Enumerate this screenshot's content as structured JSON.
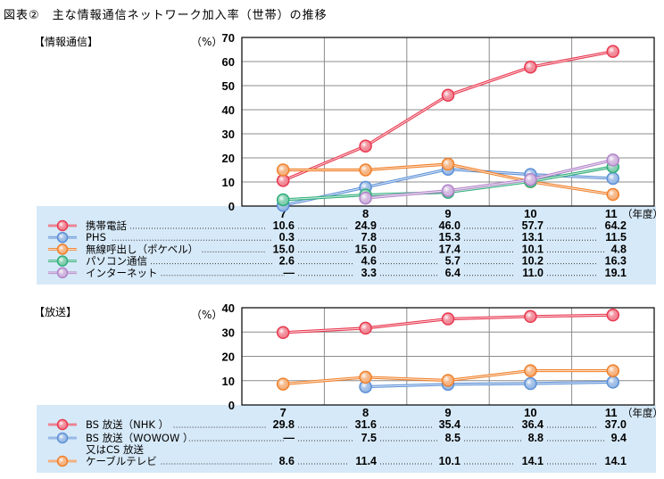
{
  "title": "図表②　主な情報通信ネットワーク加入率（世帯）の推移",
  "chart_data": [
    {
      "type": "line",
      "section_label": "【情報通信】",
      "ylabel": "（%）",
      "xlabel": "（年度）",
      "categories": [
        "7",
        "8",
        "9",
        "10",
        "11"
      ],
      "ylim": [
        0,
        70
      ],
      "yticks": [
        0,
        10,
        20,
        30,
        40,
        50,
        60,
        70
      ],
      "grid": true,
      "legend": "table-below",
      "series": [
        {
          "name": "携帯電話",
          "color": "#e8384f",
          "values": [
            10.6,
            24.9,
            46.0,
            57.7,
            64.2
          ],
          "labels": [
            "10.6",
            "24.9",
            "46.0",
            "57.7",
            "64.2"
          ]
        },
        {
          "name": "PHS",
          "color": "#5b8fd6",
          "values": [
            0.3,
            7.8,
            15.3,
            13.1,
            11.5
          ],
          "labels": [
            "0.3",
            "7.8",
            "15.3",
            "13.1",
            "11.5"
          ]
        },
        {
          "name": "無線呼出し（ポケベル）",
          "color": "#f0802a",
          "values": [
            15.0,
            15.0,
            17.4,
            10.1,
            4.8
          ],
          "labels": [
            "15.0",
            "15.0",
            "17.4",
            "10.1",
            "4.8"
          ]
        },
        {
          "name": "パソコン通信",
          "color": "#2fae7a",
          "values": [
            2.6,
            4.6,
            5.7,
            10.2,
            16.3
          ],
          "labels": [
            "2.6",
            "4.6",
            "5.7",
            "10.2",
            "16.3"
          ]
        },
        {
          "name": "インターネット",
          "color": "#b184c9",
          "values": [
            null,
            3.3,
            6.4,
            11.0,
            19.1
          ],
          "labels": [
            "—",
            "3.3",
            "6.4",
            "11.0",
            "19.1"
          ]
        }
      ]
    },
    {
      "type": "line",
      "section_label": "【放送】",
      "ylabel": "（%）",
      "xlabel": "（年度）",
      "categories": [
        "7",
        "8",
        "9",
        "10",
        "11"
      ],
      "ylim": [
        0,
        40
      ],
      "yticks": [
        0,
        10,
        20,
        30,
        40
      ],
      "grid": true,
      "legend": "table-below",
      "series": [
        {
          "name": "BS 放送（NHK ）",
          "color": "#e8384f",
          "values": [
            29.8,
            31.6,
            35.4,
            36.4,
            37.0
          ],
          "labels": [
            "29.8",
            "31.6",
            "35.4",
            "36.4",
            "37.0"
          ]
        },
        {
          "name": "BS 放送（WOWOW ）",
          "name_line2": "又はCS 放送",
          "color": "#5b8fd6",
          "values": [
            null,
            7.5,
            8.5,
            8.8,
            9.4
          ],
          "labels": [
            "—",
            "7.5",
            "8.5",
            "8.8",
            "9.4"
          ]
        },
        {
          "name": "ケーブルテレビ",
          "color": "#f0802a",
          "values": [
            8.6,
            11.4,
            10.1,
            14.1,
            14.1
          ],
          "labels": [
            "8.6",
            "11.4",
            "10.1",
            "14.1",
            "14.1"
          ]
        }
      ]
    }
  ]
}
